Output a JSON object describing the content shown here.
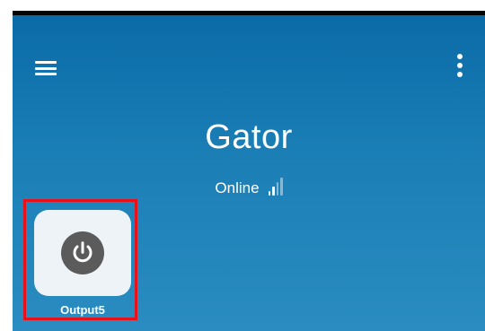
{
  "header": {
    "menu_icon": "hamburger-menu-icon",
    "more_icon": "more-vertical-icon"
  },
  "device": {
    "name": "Gator",
    "status": "Online",
    "signal_icon": "signal-strength-icon",
    "signal_bars_total": 4,
    "signal_bars_active": 2
  },
  "tiles": [
    {
      "label": "Output5",
      "icon": "power-icon"
    }
  ],
  "colors": {
    "background_top": "#0a6aa6",
    "background_bottom": "#2a8cc0",
    "tile_background": "#eef3f8",
    "power_circle": "#5b5b5b",
    "highlight": "#e8111a"
  }
}
